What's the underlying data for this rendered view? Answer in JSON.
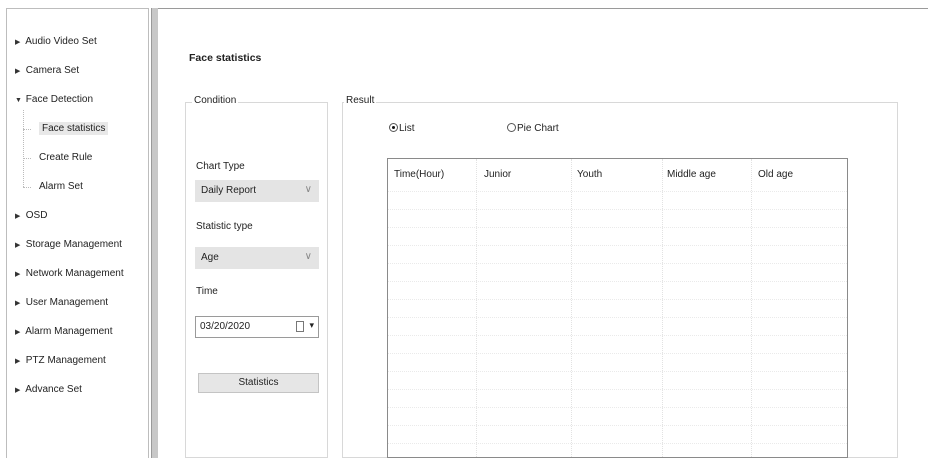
{
  "sidebar": {
    "items": [
      {
        "label": "Audio Video Set",
        "arrow": "▶"
      },
      {
        "label": "Camera Set",
        "arrow": "▶"
      },
      {
        "label": "Face Detection",
        "arrow": "▼"
      },
      {
        "label": "OSD",
        "arrow": "▶"
      },
      {
        "label": "Storage Management",
        "arrow": "▶"
      },
      {
        "label": "Network Management",
        "arrow": "▶"
      },
      {
        "label": "User Management",
        "arrow": "▶"
      },
      {
        "label": "Alarm Management",
        "arrow": "▶"
      },
      {
        "label": "PTZ Management",
        "arrow": "▶"
      },
      {
        "label": "Advance Set",
        "arrow": "▶"
      }
    ],
    "sub_items": [
      {
        "label": "Face statistics"
      },
      {
        "label": "Create Rule"
      },
      {
        "label": "Alarm Set"
      }
    ]
  },
  "page": {
    "title": "Face statistics"
  },
  "condition": {
    "label": "Condition",
    "chart_type_label": "Chart Type",
    "chart_type_value": "Daily Report",
    "statistic_type_label": "Statistic type",
    "statistic_type_value": "Age",
    "time_label": "Time",
    "time_value": "03/20/2020",
    "statistics_button": "Statistics",
    "chevron": "∨"
  },
  "result": {
    "label": "Result",
    "list_option": "List",
    "pie_option": "Pie Chart",
    "selected": "List",
    "columns": [
      "Time(Hour)",
      "Junior",
      "Youth",
      "Middle age",
      "Old age"
    ]
  }
}
